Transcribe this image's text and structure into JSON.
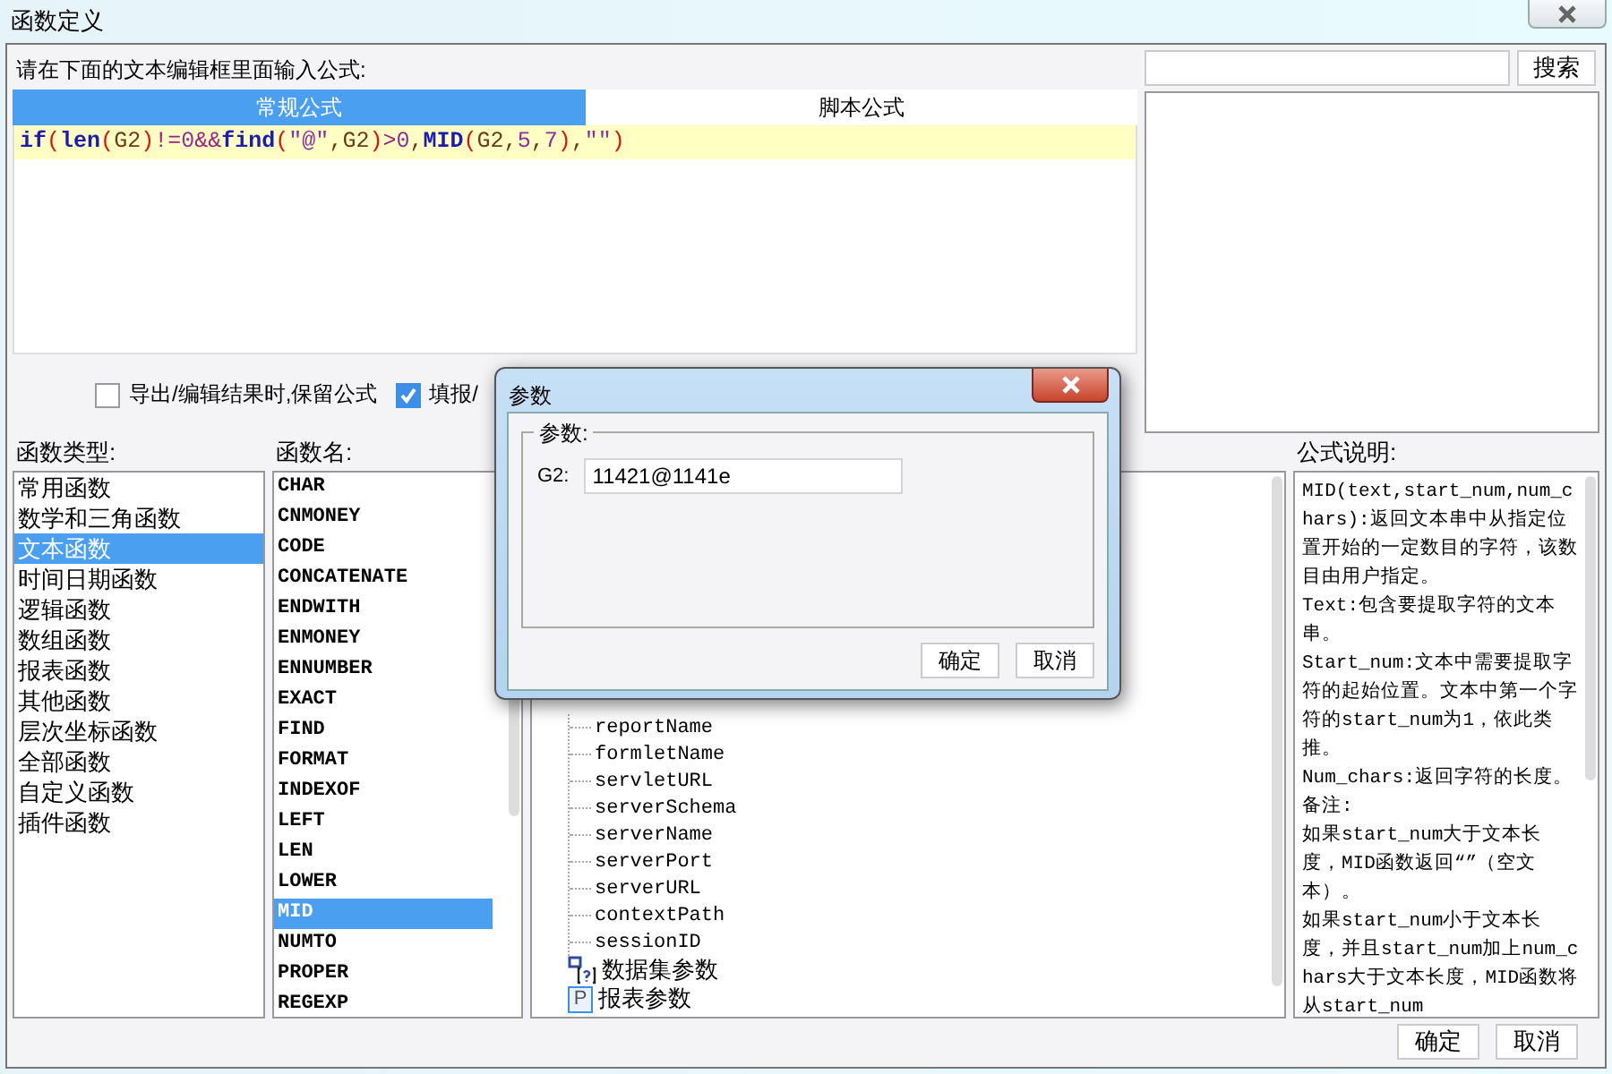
{
  "window": {
    "title": "函数定义"
  },
  "editor": {
    "prompt": "请在下面的文本编辑框里面输入公式:",
    "tabs": [
      {
        "label": "常规公式",
        "selected": true
      },
      {
        "label": "脚本公式",
        "selected": false
      }
    ],
    "formula": [
      {
        "text": "if",
        "kind": "keyword"
      },
      {
        "text": "(",
        "kind": "paren"
      },
      {
        "text": "len",
        "kind": "keyword"
      },
      {
        "text": "(",
        "kind": "paren"
      },
      {
        "text": "G2",
        "kind": "plain"
      },
      {
        "text": ")",
        "kind": "paren"
      },
      {
        "text": "!=",
        "kind": "operator"
      },
      {
        "text": "0",
        "kind": "number"
      },
      {
        "text": "&&",
        "kind": "operator"
      },
      {
        "text": "find",
        "kind": "keyword"
      },
      {
        "text": "(",
        "kind": "paren"
      },
      {
        "text": "\"@\"",
        "kind": "string"
      },
      {
        "text": ",G2",
        "kind": "plain"
      },
      {
        "text": ")",
        "kind": "paren"
      },
      {
        "text": ">",
        "kind": "operator"
      },
      {
        "text": "0",
        "kind": "number"
      },
      {
        "text": ",",
        "kind": "plain"
      },
      {
        "text": "MID",
        "kind": "keyword"
      },
      {
        "text": "(",
        "kind": "paren"
      },
      {
        "text": "G2,",
        "kind": "plain"
      },
      {
        "text": "5",
        "kind": "number"
      },
      {
        "text": ",",
        "kind": "plain"
      },
      {
        "text": "7",
        "kind": "number"
      },
      {
        "text": ")",
        "kind": "paren"
      },
      {
        "text": ",",
        "kind": "plain"
      },
      {
        "text": "\"\"",
        "kind": "string"
      },
      {
        "text": ")",
        "kind": "paren"
      }
    ]
  },
  "options": [
    {
      "label": "导出/编辑结果时,保留公式",
      "checked": false
    },
    {
      "label": "填报/",
      "checked": true
    }
  ],
  "search": {
    "button": "搜索"
  },
  "function_types": {
    "label": "函数类型:",
    "items": [
      {
        "label": "常用函数",
        "selected": false
      },
      {
        "label": "数学和三角函数",
        "selected": false
      },
      {
        "label": "文本函数",
        "selected": true
      },
      {
        "label": "时间日期函数",
        "selected": false
      },
      {
        "label": "逻辑函数",
        "selected": false
      },
      {
        "label": "数组函数",
        "selected": false
      },
      {
        "label": "报表函数",
        "selected": false
      },
      {
        "label": "其他函数",
        "selected": false
      },
      {
        "label": "层次坐标函数",
        "selected": false
      },
      {
        "label": "全部函数",
        "selected": false
      },
      {
        "label": "自定义函数",
        "selected": false
      },
      {
        "label": "插件函数",
        "selected": false
      }
    ]
  },
  "function_names": {
    "label": "函数名:",
    "items": [
      {
        "label": "CHAR",
        "selected": false
      },
      {
        "label": "CNMONEY",
        "selected": false
      },
      {
        "label": "CODE",
        "selected": false
      },
      {
        "label": "CONCATENATE",
        "selected": false
      },
      {
        "label": "ENDWITH",
        "selected": false
      },
      {
        "label": "ENMONEY",
        "selected": false
      },
      {
        "label": "ENNUMBER",
        "selected": false
      },
      {
        "label": "EXACT",
        "selected": false
      },
      {
        "label": "FIND",
        "selected": false
      },
      {
        "label": "FORMAT",
        "selected": false
      },
      {
        "label": "INDEXOF",
        "selected": false
      },
      {
        "label": "LEFT",
        "selected": false
      },
      {
        "label": "LEN",
        "selected": false
      },
      {
        "label": "LOWER",
        "selected": false
      },
      {
        "label": "MID",
        "selected": true
      },
      {
        "label": "NUMTO",
        "selected": false
      },
      {
        "label": "PROPER",
        "selected": false
      },
      {
        "label": "REGEXP",
        "selected": false
      }
    ]
  },
  "parameter_tree": [
    {
      "kind": "group",
      "children": [
        {
          "label": "reportName",
          "kind": "leaf"
        },
        {
          "label": "formletName",
          "kind": "leaf"
        },
        {
          "label": "servletURL",
          "kind": "leaf"
        },
        {
          "label": "serverSchema",
          "kind": "leaf"
        },
        {
          "label": "serverName",
          "kind": "leaf"
        },
        {
          "label": "serverPort",
          "kind": "leaf"
        },
        {
          "label": "serverURL",
          "kind": "leaf"
        },
        {
          "label": "contextPath",
          "kind": "leaf"
        },
        {
          "label": "sessionID",
          "kind": "leaf"
        }
      ]
    },
    {
      "label": "数据集参数",
      "kind": "dataset"
    },
    {
      "label": "报表参数",
      "kind": "param",
      "icon": "P"
    }
  ],
  "description": {
    "label": "公式说明:",
    "paragraphs": [
      "MID(text,start_num,num_chars):返回文本串中从指定位置开始的一定数目的字符，该数目由用户指定。",
      "Text:包含要提取字符的文本串。",
      "Start_num:文本中需要提取字符的起始位置。文本中第一个字符的start_num为1，依此类推。",
      "Num_chars:返回字符的长度。",
      "备注:",
      "如果start_num大于文本长度，MID函数返回“”（空文本）。",
      "如果start_num小于文本长度，并且start_num加上num_chars大于文本长度，MID函数将从start_num"
    ]
  },
  "buttons": [
    "确定",
    "取消"
  ],
  "dialog": {
    "title": "参数",
    "group": "参数:",
    "fields": [
      {
        "label": "G2:",
        "value": "11421@1141e"
      }
    ],
    "buttons": [
      "确定",
      "取消"
    ]
  }
}
